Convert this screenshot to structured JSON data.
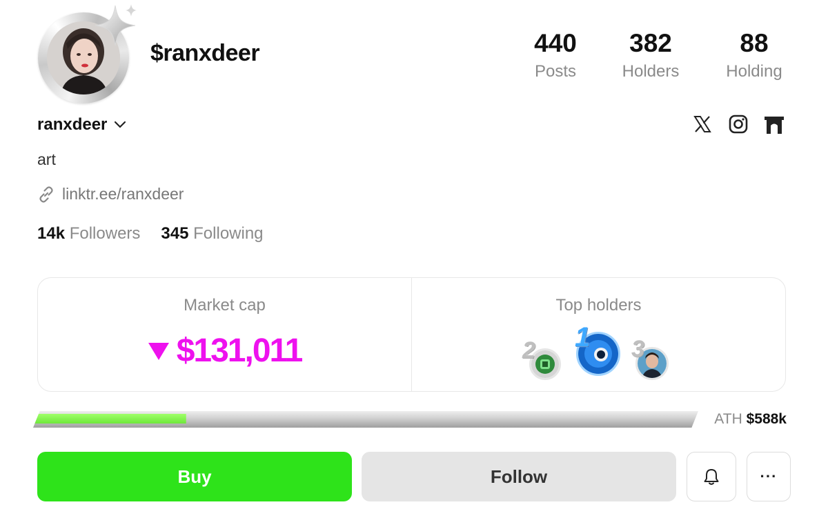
{
  "profile": {
    "token_name": "$ranxdeer",
    "handle": "ranxdeer",
    "bio": "art",
    "link": "linktr.ee/ranxdeer",
    "followers_count": "14k",
    "followers_label": "Followers",
    "following_count": "345",
    "following_label": "Following"
  },
  "stats": [
    {
      "value": "440",
      "label": "Posts"
    },
    {
      "value": "382",
      "label": "Holders"
    },
    {
      "value": "88",
      "label": "Holding"
    }
  ],
  "socials": [
    "x-icon",
    "instagram-icon",
    "gate-icon"
  ],
  "market": {
    "label": "Market cap",
    "value": "$131,011",
    "trend": "down",
    "trend_color": "#ee11ee"
  },
  "top_holders": {
    "label": "Top holders",
    "ranks": [
      "1",
      "2",
      "3"
    ]
  },
  "progress": {
    "fraction": 0.23,
    "ath_label": "ATH",
    "ath_value": "$588k"
  },
  "actions": {
    "buy_label": "Buy",
    "follow_label": "Follow",
    "more_label": "···"
  },
  "colors": {
    "buy": "#2ee31a",
    "progress_fill": "#7cf04a",
    "market_cap": "#ee11ee"
  }
}
